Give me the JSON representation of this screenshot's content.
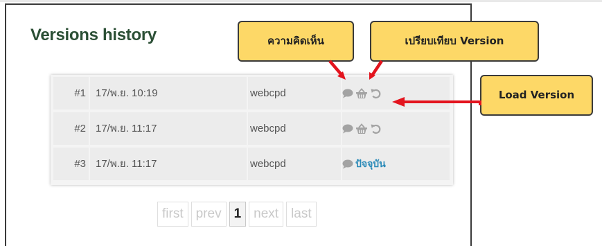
{
  "page": {
    "title": "Versions history"
  },
  "versions": [
    {
      "num": "#1",
      "date": "17/พ.ย. 10:19",
      "user": "webcpd",
      "is_current": false,
      "icons": [
        "comment-icon",
        "compare-icon",
        "load-icon"
      ]
    },
    {
      "num": "#2",
      "date": "17/พ.ย. 11:17",
      "user": "webcpd",
      "is_current": false,
      "icons": [
        "comment-icon",
        "compare-icon",
        "load-icon"
      ]
    },
    {
      "num": "#3",
      "date": "17/พ.ย. 11:17",
      "user": "webcpd",
      "is_current": true,
      "icons": [
        "comment-icon"
      ],
      "current_label": "ปัจจุบัน"
    }
  ],
  "pagination": {
    "first": "first",
    "prev": "prev",
    "current": "1",
    "next": "next",
    "last": "last"
  },
  "callouts": {
    "comment": "ความคิดเห็น",
    "compare": "เปรียบเทียบ Version",
    "load": "Load Version"
  },
  "colors": {
    "title": "#2b4f35",
    "callout_fill": "#fdd867",
    "arrow": "#e3141e",
    "current_link": "#2a8ab8",
    "icon": "#a3a3a3"
  }
}
